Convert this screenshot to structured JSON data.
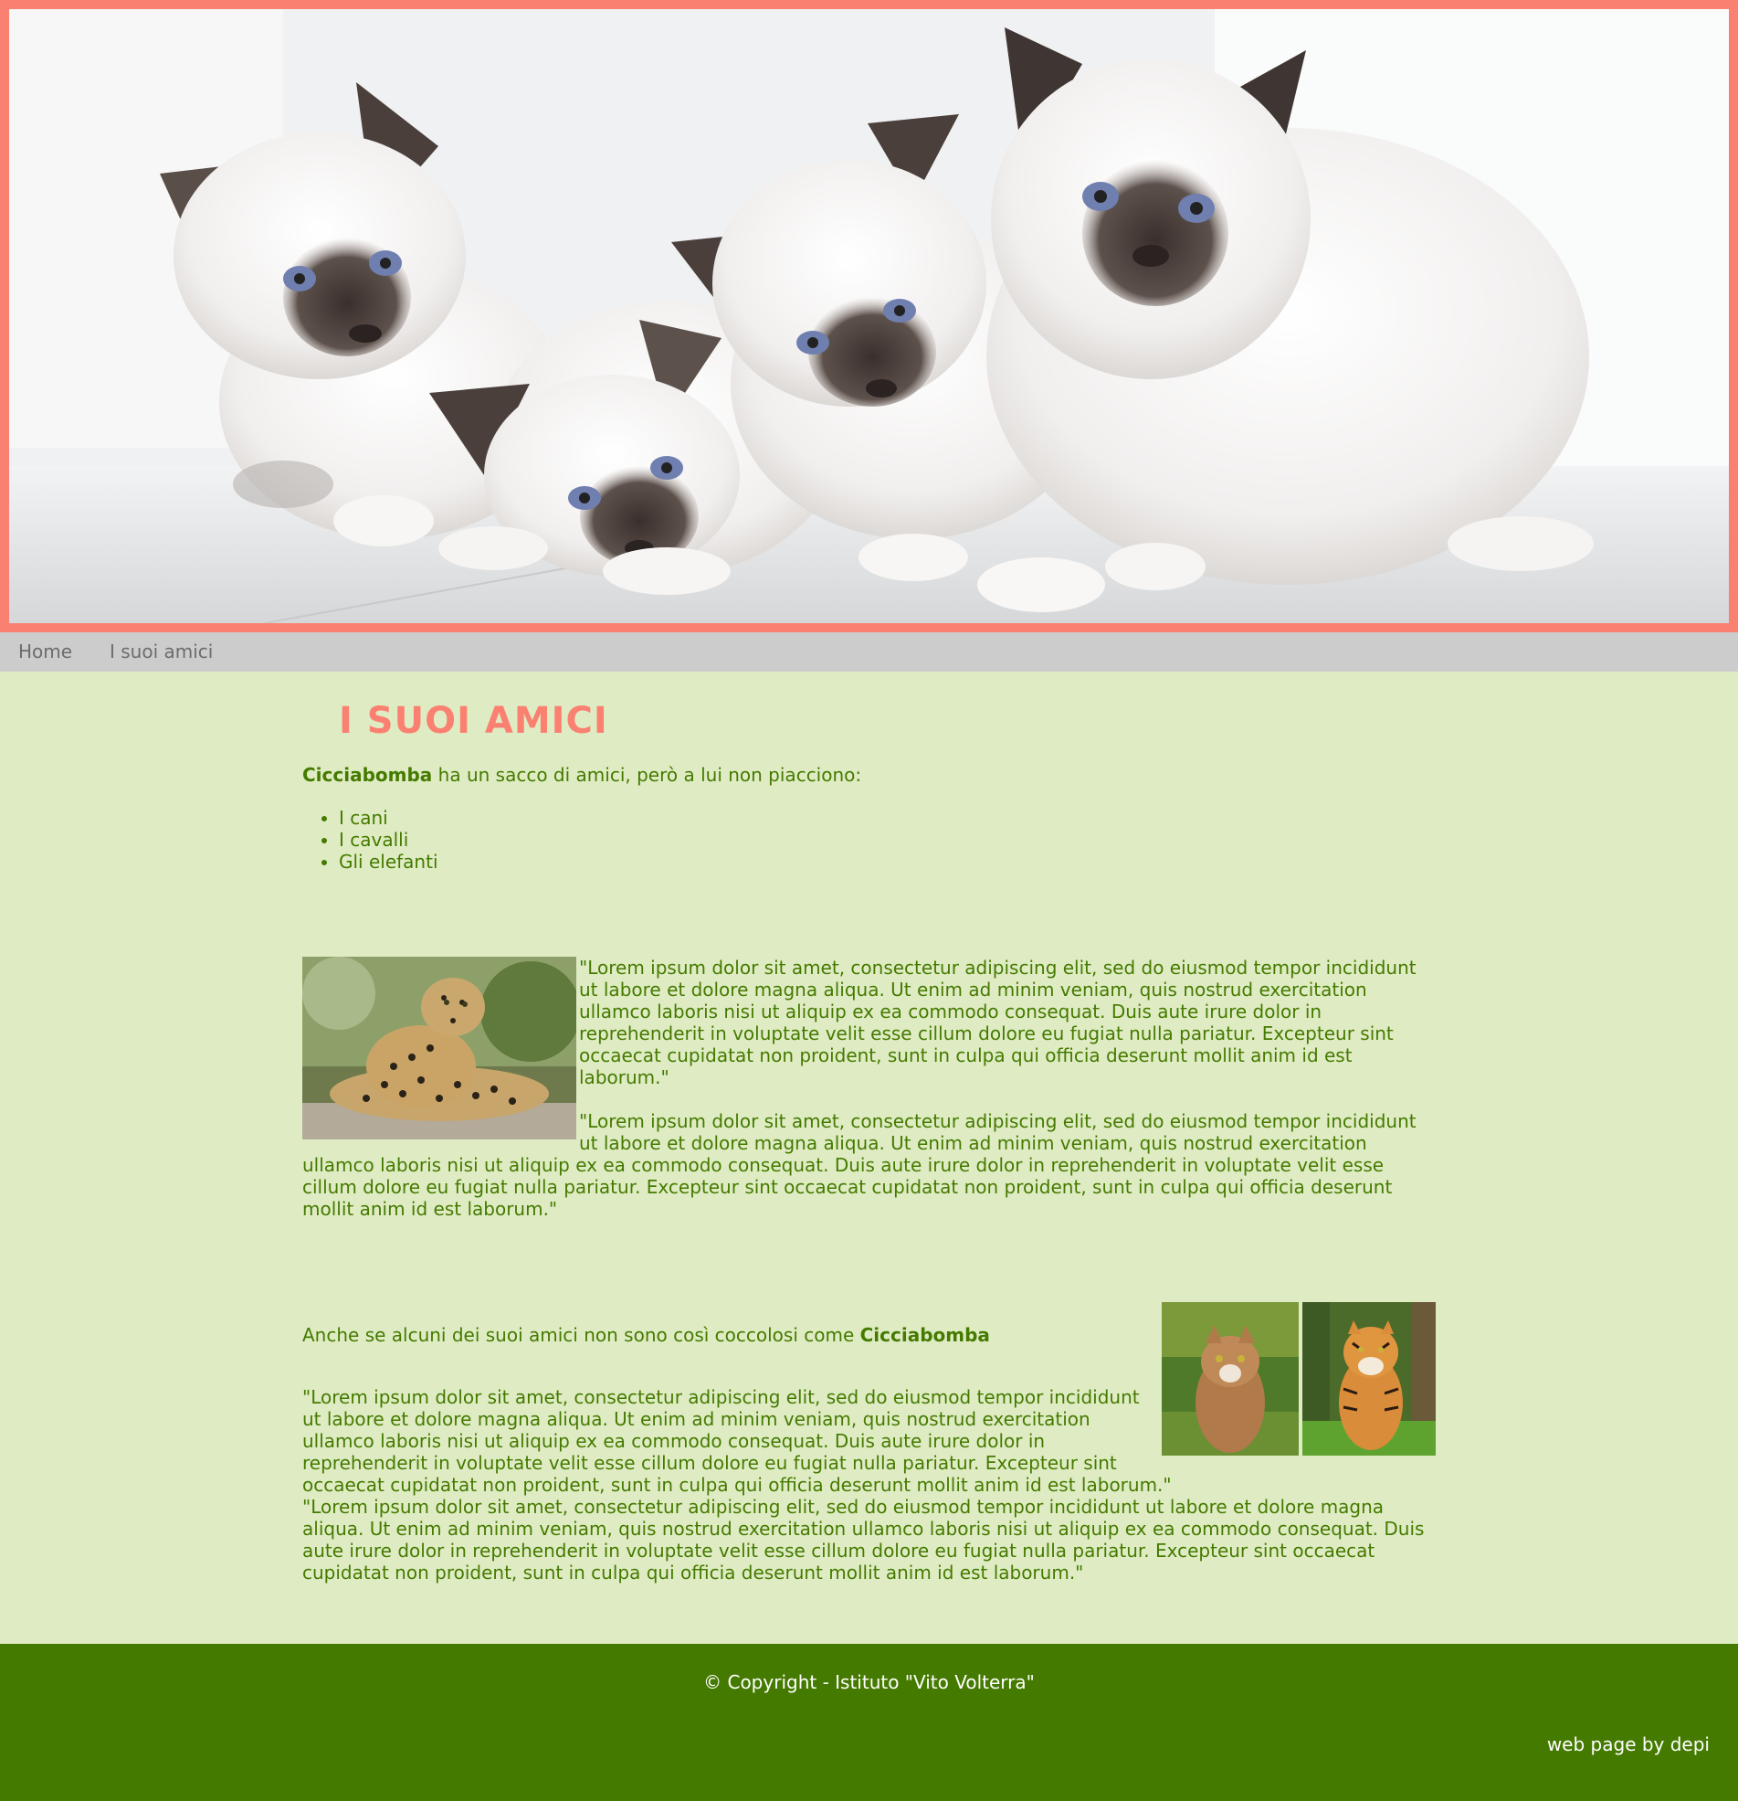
{
  "banner": {
    "image": "four-birman-kittens-photo",
    "border_color": "#fa8072"
  },
  "nav": {
    "items": [
      {
        "label": "Home"
      },
      {
        "label": "I suoi amici"
      }
    ]
  },
  "main": {
    "title": "I SUOI AMICI",
    "intro": {
      "name": "Cicciabomba",
      "text": " ha un sacco di amici, però a lui non piacciono:"
    },
    "dislikes": [
      "I cani",
      "I cavalli",
      "Gli elefanti"
    ],
    "block1": {
      "image": "leopard-photo",
      "paragraphs": [
        "\"Lorem ipsum dolor sit amet, consectetur adipiscing elit, sed do eiusmod tempor incididunt ut labore et dolore magna aliqua. Ut enim ad minim veniam, quis nostrud exercitation ullamco laboris nisi ut aliquip ex ea commodo consequat. Duis aute irure dolor in reprehenderit in voluptate velit esse cillum dolore eu fugiat nulla pariatur. Excepteur sint occaecat cupidatat non proident, sunt in culpa qui officia deserunt mollit anim id est laborum.\"",
        "\"Lorem ipsum dolor sit amet, consectetur adipiscing elit, sed do eiusmod tempor incididunt ut labore et dolore magna aliqua. Ut enim ad minim veniam, quis nostrud exercitation ullamco laboris nisi ut aliquip ex ea commodo consequat. Duis aute irure dolor in reprehenderit in voluptate velit esse cillum dolore eu fugiat nulla pariatur. Excepteur sint occaecat cupidatat non proident, sunt in culpa qui officia deserunt mollit anim id est laborum.\""
      ]
    },
    "block2": {
      "images": [
        "orange-cat-photo",
        "tiger-photo"
      ],
      "lead_text": "Anche se alcuni dei suoi amici non sono così coccolosi come ",
      "lead_name": "Cicciabomba",
      "paragraphs": [
        "\"Lorem ipsum dolor sit amet, consectetur adipiscing elit, sed do eiusmod tempor incididunt ut labore et dolore magna aliqua. Ut enim ad minim veniam, quis nostrud exercitation ullamco laboris nisi ut aliquip ex ea commodo consequat. Duis aute irure dolor in reprehenderit in voluptate velit esse cillum dolore eu fugiat nulla pariatur. Excepteur sint occaecat cupidatat non proident, sunt in culpa qui officia deserunt mollit anim id est laborum.\"",
        "\"Lorem ipsum dolor sit amet, consectetur adipiscing elit, sed do eiusmod tempor incididunt ut labore et dolore magna aliqua. Ut enim ad minim veniam, quis nostrud exercitation ullamco laboris nisi ut aliquip ex ea commodo consequat. Duis aute irure dolor in reprehenderit in voluptate velit esse cillum dolore eu fugiat nulla pariatur. Excepteur sint occaecat cupidatat non proident, sunt in culpa qui officia deserunt mollit anim id est laborum.\""
      ]
    }
  },
  "footer": {
    "copyright": "© Copyright - Istituto \"Vito Volterra\"",
    "credit": "web page by depi"
  },
  "colors": {
    "accent": "#fa8072",
    "text_green": "#457a00",
    "page_bg": "#dfecc3",
    "nav_bg": "#cccccc",
    "footer_bg": "#457a00"
  }
}
